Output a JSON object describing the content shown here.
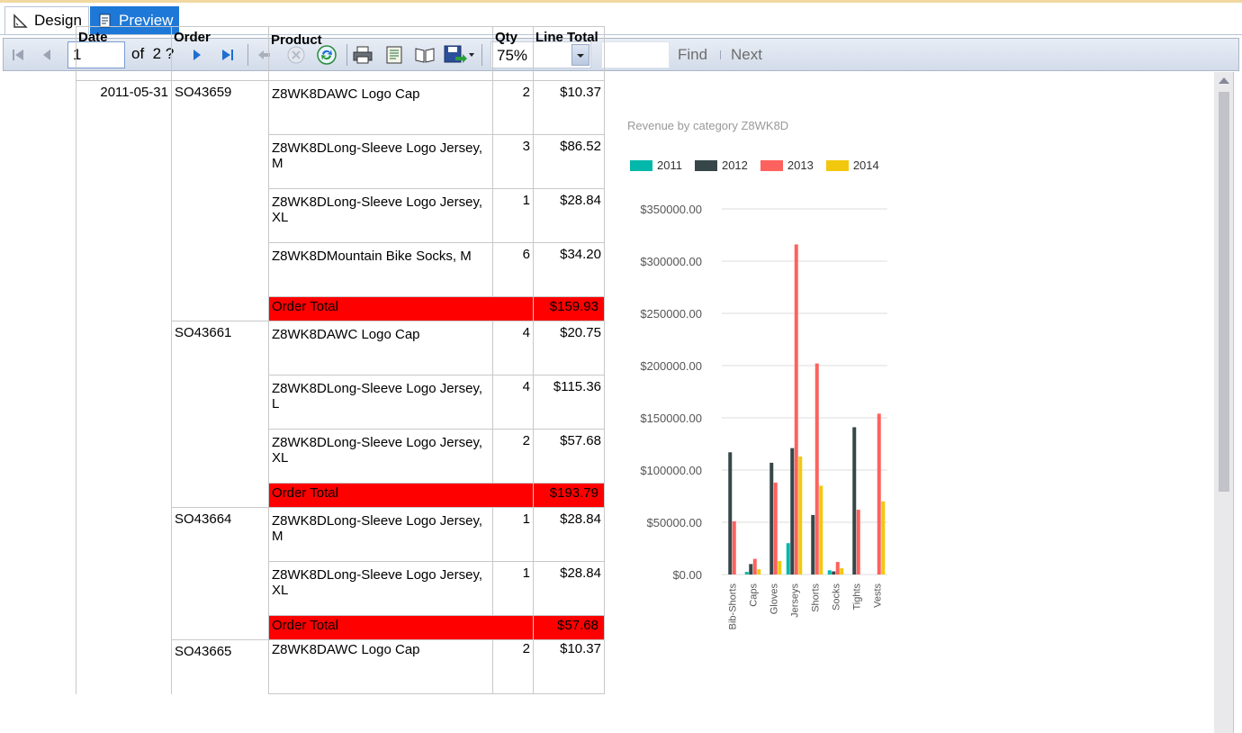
{
  "tabs": [
    {
      "label": "Design",
      "active": false
    },
    {
      "label": "Preview",
      "active": true
    }
  ],
  "toolbar": {
    "page_value": "1",
    "of_text": "of",
    "total_pages": "2 ?",
    "zoom": "75%",
    "find_label": "Find",
    "next_label": "Next"
  },
  "report": {
    "headers": {
      "date": "Date",
      "order": "Order",
      "product": "Product",
      "qty": "Qty",
      "line_total": "Line Total"
    },
    "date": "2011-05-31",
    "order_total_label": "Order Total",
    "orders": [
      {
        "order": "SO43659",
        "lines": [
          {
            "product": "Z8WK8DAWC Logo Cap",
            "qty": "2",
            "total": "$10.37"
          },
          {
            "product": "Z8WK8DLong-Sleeve Logo Jersey, M",
            "qty": "3",
            "total": "$86.52"
          },
          {
            "product": "Z8WK8DLong-Sleeve Logo Jersey, XL",
            "qty": "1",
            "total": "$28.84"
          },
          {
            "product": "Z8WK8DMountain Bike Socks, M",
            "qty": "6",
            "total": "$34.20"
          }
        ],
        "order_total": "$159.93"
      },
      {
        "order": "SO43661",
        "lines": [
          {
            "product": "Z8WK8DAWC Logo Cap",
            "qty": "4",
            "total": "$20.75"
          },
          {
            "product": "Z8WK8DLong-Sleeve Logo Jersey, L",
            "qty": "4",
            "total": "$115.36"
          },
          {
            "product": "Z8WK8DLong-Sleeve Logo Jersey, XL",
            "qty": "2",
            "total": "$57.68"
          }
        ],
        "order_total": "$193.79"
      },
      {
        "order": "SO43664",
        "lines": [
          {
            "product": "Z8WK8DLong-Sleeve Logo Jersey, M",
            "qty": "1",
            "total": "$28.84"
          },
          {
            "product": "Z8WK8DLong-Sleeve Logo Jersey, XL",
            "qty": "1",
            "total": "$28.84"
          }
        ],
        "order_total": "$57.68"
      },
      {
        "order": "SO43665",
        "lines": [
          {
            "product": "Z8WK8DAWC Logo Cap",
            "qty": "2",
            "total": "$10.37"
          }
        ]
      }
    ]
  },
  "colors": {
    "order_total_bg": "#ff0000",
    "tab_active": "#1e78d7"
  },
  "chart_data": {
    "type": "bar",
    "title": "Revenue by category Z8WK8D",
    "categories": [
      "Bib-Shorts",
      "Caps",
      "Gloves",
      "Jerseys",
      "Shorts",
      "Socks",
      "Tights",
      "Vests"
    ],
    "series": [
      {
        "name": "2011",
        "color": "#01b8aa",
        "values": [
          0,
          2500,
          0,
          30000,
          0,
          4000,
          0,
          0
        ]
      },
      {
        "name": "2012",
        "color": "#374649",
        "values": [
          117000,
          10000,
          107000,
          121000,
          57000,
          3000,
          141000,
          0
        ]
      },
      {
        "name": "2013",
        "color": "#fd625e",
        "values": [
          51000,
          15000,
          88000,
          316000,
          202000,
          12000,
          62000,
          154000
        ]
      },
      {
        "name": "2014",
        "color": "#f2c80f",
        "values": [
          0,
          5000,
          13000,
          113000,
          85000,
          6000,
          0,
          70000
        ]
      }
    ],
    "ylim": [
      0,
      350000
    ],
    "yticks": [
      "$0.00",
      "$50000.00",
      "$100000.00",
      "$150000.00",
      "$200000.00",
      "$250000.00",
      "$300000.00",
      "$350000.00"
    ],
    "legend": "top-left",
    "grid": true
  }
}
